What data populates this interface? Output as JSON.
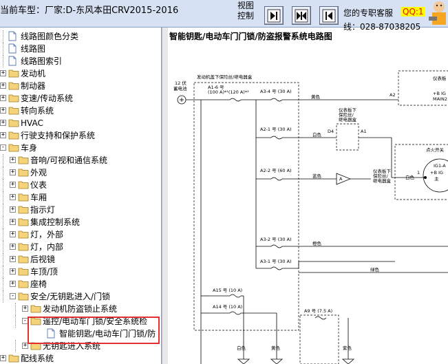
{
  "header": {
    "car_model": "当前车型：厂家:D-东风本田CRV2015-2016",
    "view_control": "视图控制",
    "service_label": "您的专职客服",
    "qq_label": "QQ:1",
    "phone_label": "线：028-87038205",
    "nav_buttons": [
      "prev-page",
      "fit-page",
      "next-page"
    ]
  },
  "tree": {
    "items": [
      {
        "label": "线路图颜色分类",
        "level": 1,
        "type": "page"
      },
      {
        "label": "线路图",
        "level": 1,
        "type": "page"
      },
      {
        "label": "线路图索引",
        "level": 1,
        "type": "page"
      },
      {
        "label": "发动机",
        "level": 0,
        "type": "folder",
        "state": "+"
      },
      {
        "label": "制动器",
        "level": 0,
        "type": "folder",
        "state": "+"
      },
      {
        "label": "变速/传动系统",
        "level": 0,
        "type": "folder",
        "state": "+"
      },
      {
        "label": "转向系统",
        "level": 0,
        "type": "folder",
        "state": "+"
      },
      {
        "label": "HVAC",
        "level": 0,
        "type": "folder",
        "state": "+"
      },
      {
        "label": "行驶支持和保护系统",
        "level": 0,
        "type": "folder",
        "state": "+"
      },
      {
        "label": "车身",
        "level": 0,
        "type": "folder",
        "state": "-"
      },
      {
        "label": "音响/可视和通信系统",
        "level": 1,
        "type": "folder",
        "state": "+"
      },
      {
        "label": "外观",
        "level": 1,
        "type": "folder",
        "state": "+"
      },
      {
        "label": "仪表",
        "level": 1,
        "type": "folder",
        "state": "+"
      },
      {
        "label": "车厢",
        "level": 1,
        "type": "folder",
        "state": "+"
      },
      {
        "label": "指示灯",
        "level": 1,
        "type": "folder",
        "state": "+"
      },
      {
        "label": "集成控制系统",
        "level": 1,
        "type": "folder",
        "state": "+"
      },
      {
        "label": "灯，外部",
        "level": 1,
        "type": "folder",
        "state": "+"
      },
      {
        "label": "灯，内部",
        "level": 1,
        "type": "folder",
        "state": "+"
      },
      {
        "label": "后视镜",
        "level": 1,
        "type": "folder",
        "state": "+"
      },
      {
        "label": "车顶/顶",
        "level": 1,
        "type": "folder",
        "state": "+"
      },
      {
        "label": "座椅",
        "level": 1,
        "type": "folder",
        "state": "+"
      },
      {
        "label": "安全/无钥匙进入/门锁",
        "level": 1,
        "type": "folder",
        "state": "-"
      },
      {
        "label": "发动机防盗锁止系统",
        "level": 2,
        "type": "folder",
        "state": "+"
      },
      {
        "label": "遥控/电动车门锁/安全系统检",
        "level": 2,
        "type": "folder",
        "state": "-"
      },
      {
        "label": "智能钥匙/电动车门门锁/防",
        "level": 3,
        "type": "page",
        "selected": true
      },
      {
        "label": "无钥匙进入系统",
        "level": 2,
        "type": "folder",
        "state": "+"
      },
      {
        "label": "配线系统",
        "level": 0,
        "type": "folder",
        "state": "+"
      }
    ]
  },
  "diagram": {
    "title": "智能钥匙/电动车门门锁/防盗报警系统电路图",
    "box_label": "发动机盖下保险丝/继电器盒",
    "battery_label": [
      "12 伏",
      "蓄电池"
    ],
    "fuses": [
      {
        "label": "A1-6 号",
        "sub": "(100 A)*¹(120 A)*²"
      },
      {
        "label": "A3-4 号 (30 A)"
      },
      {
        "label": "A2-1 号 (30 A)"
      },
      {
        "label": "A2-2 号 (60 A)"
      },
      {
        "label": "A3-2 号 (30 A)"
      },
      {
        "label": "A3-1 号 (30 A)"
      },
      {
        "label": "A15 号 (10 A)"
      },
      {
        "label": "A14 号 (10 A)"
      },
      {
        "label": "A9 号 (7.5 A)"
      }
    ],
    "wire_colors": [
      "黄色",
      "白色",
      "蓝色",
      "橙色",
      "绿色",
      "白色",
      "黄色",
      "紫色"
    ],
    "relay_labels": [
      "仪表板下",
      "保险丝/",
      "继电器盒"
    ],
    "relay2_labels": [
      "仪表板下",
      "保险丝/",
      "继电器盒"
    ],
    "connector_labels": {
      "d4": "D4",
      "a1": "A1",
      "a2": "A2"
    },
    "right_box_labels": [
      "仪表板",
      "+B IG",
      "MAIN2"
    ],
    "ignition_labels": [
      "点火开关",
      "IG1-A",
      "+B IG",
      "主"
    ],
    "pin_number": "1",
    "diode_label": "A"
  }
}
